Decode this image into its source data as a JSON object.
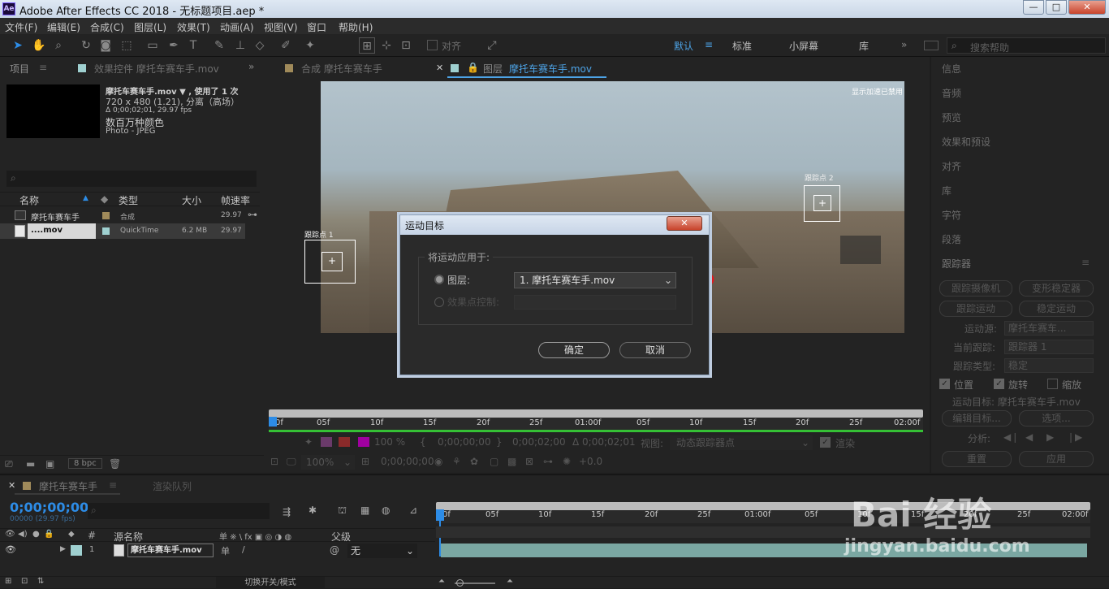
{
  "window": {
    "title": "Adobe After Effects CC 2018 - 无标题项目.aep *",
    "logo": "Ae",
    "min": "—",
    "max": "□",
    "close": "✕"
  },
  "menu": [
    "文件(F)",
    "编辑(E)",
    "合成(C)",
    "图层(L)",
    "效果(T)",
    "动画(A)",
    "视图(V)",
    "窗口",
    "帮助(H)"
  ],
  "toolbar": {
    "snap_label": "对齐",
    "workspaces": [
      "默认",
      "标准",
      "小屏幕",
      "库"
    ],
    "search_placeholder": "搜索帮助",
    "more": "»"
  },
  "project": {
    "tab_project": "项目",
    "tab_effects": "效果控件 摩托车赛车手.mov",
    "file_name": "摩托车赛车手.mov ▼ , 使用了 1 次",
    "dims": "720 x 480 (1.21), 分离（高场）",
    "duration": "Δ 0;00;02;01, 29.97 fps",
    "colors": "数百万种颜色",
    "codec": "Photo - JPEG",
    "search_placeholder": "",
    "columns": {
      "name": "名称",
      "type": "类型",
      "size": "大小",
      "fps": "帧速率"
    },
    "rows": [
      {
        "name": "摩托车赛车手",
        "type": "合成",
        "size": "",
        "fps": "29.97",
        "color": "#a08a5a"
      },
      {
        "name": "....mov",
        "type": "QuickTime",
        "size": "6.2 MB",
        "fps": "29.97",
        "color": "#9fd0d0"
      }
    ],
    "bpc": "8 bpc"
  },
  "viewer": {
    "tab_comp": "合成 摩托车赛车手",
    "tab_layer_prefix": "图层",
    "tab_layer": "摩托车赛车手.mov",
    "accel_note": "显示加速已禁用",
    "track_point_1": "跟踪点 1",
    "track_point_2": "跟踪点 2",
    "ruler": [
      "0f",
      "05f",
      "10f",
      "15f",
      "20f",
      "25f",
      "01:00f",
      "05f",
      "10f",
      "15f",
      "20f",
      "25f",
      "02:00f"
    ],
    "zoom_pct": "100 %",
    "time_in": "0;00;00;00",
    "time_out": "0;00;02;00",
    "duration": "Δ 0;00;02;01",
    "view_label": "视图:",
    "view_value": "动态跟踪器点",
    "render_label": "渲染",
    "zoom2": "100%",
    "time_cur": "0;00;00;00",
    "exposure": "+0.0"
  },
  "dialog": {
    "title": "运动目标",
    "close": "✕",
    "group_label": "将运动应用于:",
    "layer_label": "图层:",
    "layer_value": "1. 摩托车赛车手.mov",
    "effect_label": "效果点控制:",
    "ok": "确定",
    "cancel": "取消"
  },
  "right_panel": {
    "items": [
      "信息",
      "音频",
      "预览",
      "效果和预设",
      "对齐",
      "库",
      "字符",
      "段落"
    ],
    "tracker_title": "跟踪器",
    "btn_camera": "跟踪摄像机",
    "btn_warp": "变形稳定器",
    "btn_motion": "跟踪运动",
    "btn_stabilize": "稳定运动",
    "source_label": "运动源:",
    "source_value": "摩托车赛车...",
    "current_label": "当前跟踪:",
    "current_value": "跟踪器 1",
    "type_label": "跟踪类型:",
    "type_value": "稳定",
    "cb_position": "位置",
    "cb_rotation": "旋转",
    "cb_scale": "缩放",
    "target": "运动目标: 摩托车赛车手.mov",
    "btn_edit": "编辑目标...",
    "btn_options": "选项...",
    "analyze_label": "分析:",
    "btn_reset": "重置",
    "btn_apply": "应用"
  },
  "timeline": {
    "tab_comp": "摩托车赛车手",
    "tab_render": "渲染队列",
    "timecode": "0;00;00;00",
    "frames": "00000 (29.97 fps)",
    "col_hash": "#",
    "col_source": "源名称",
    "col_switches": "单 ※ \\ fx ▣ ◎ ◑ ◍",
    "col_parent": "父级",
    "layer_index": "1",
    "layer_name": "摩托车赛车手.mov",
    "parent_value": "无",
    "ruler": [
      "0f",
      "05f",
      "10f",
      "15f",
      "20f",
      "25f",
      "01:00f",
      "05f",
      "10f",
      "15f",
      "20f",
      "25f",
      "02:00f"
    ],
    "toggle_label": "切换开关/模式"
  },
  "watermark": {
    "brand": "Bai 经验",
    "url": "jingyan.baidu.com"
  }
}
